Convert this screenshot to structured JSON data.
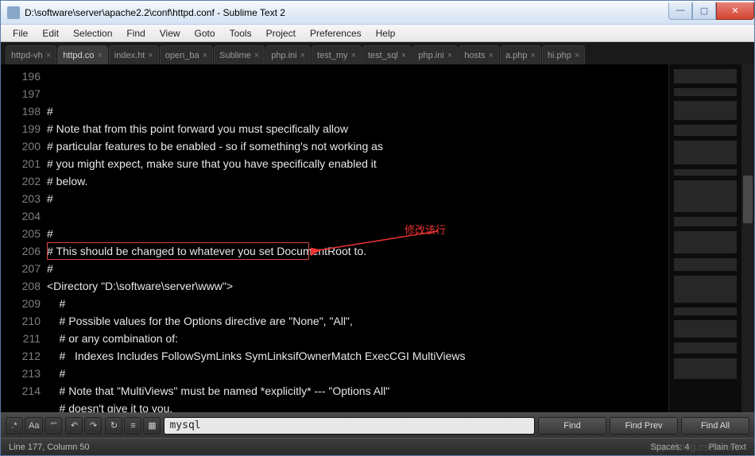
{
  "title": "D:\\software\\server\\apache2.2\\conf\\httpd.conf - Sublime Text 2",
  "menu": [
    "File",
    "Edit",
    "Selection",
    "Find",
    "View",
    "Goto",
    "Tools",
    "Project",
    "Preferences",
    "Help"
  ],
  "tabs": [
    {
      "label": "httpd-vh",
      "active": false
    },
    {
      "label": "httpd.co",
      "active": true
    },
    {
      "label": "index.ht",
      "active": false
    },
    {
      "label": "open_ba",
      "active": false
    },
    {
      "label": "Sublime",
      "active": false
    },
    {
      "label": "php.ini",
      "active": false
    },
    {
      "label": "test_my",
      "active": false
    },
    {
      "label": "test_sql",
      "active": false
    },
    {
      "label": "php.ini",
      "active": false
    },
    {
      "label": "hosts",
      "active": false
    },
    {
      "label": "a.php",
      "active": false
    },
    {
      "label": "hi.php",
      "active": false
    }
  ],
  "lines": [
    {
      "n": 196,
      "t": "#"
    },
    {
      "n": 197,
      "t": "# Note that from this point forward you must specifically allow"
    },
    {
      "n": 198,
      "t": "# particular features to be enabled - so if something's not working as"
    },
    {
      "n": 199,
      "t": "# you might expect, make sure that you have specifically enabled it"
    },
    {
      "n": 200,
      "t": "# below."
    },
    {
      "n": 201,
      "t": "#"
    },
    {
      "n": 202,
      "t": ""
    },
    {
      "n": 203,
      "t": "#"
    },
    {
      "n": 204,
      "t": "# This should be changed to whatever you set DocumentRoot to."
    },
    {
      "n": 205,
      "t": "#"
    },
    {
      "n": 206,
      "t": "<Directory \"D:\\software\\server\\www\">"
    },
    {
      "n": 207,
      "t": "    #"
    },
    {
      "n": 208,
      "t": "    # Possible values for the Options directive are \"None\", \"All\","
    },
    {
      "n": 209,
      "t": "    # or any combination of:"
    },
    {
      "n": 210,
      "t": "    #   Indexes Includes FollowSymLinks SymLinksifOwnerMatch ExecCGI MultiViews"
    },
    {
      "n": 211,
      "t": "    #"
    },
    {
      "n": 212,
      "t": "    # Note that \"MultiViews\" must be named *explicitly* --- \"Options All\""
    },
    {
      "n": 213,
      "t": "    # doesn't give it to you."
    },
    {
      "n": 214,
      "t": "    #"
    }
  ],
  "annotation": "修改该行",
  "find": {
    "value": "mysql",
    "regex_icon": ".*",
    "case_icon": "Aa",
    "word_icon": "“”",
    "undo_icon": "↶",
    "redo_icon": "↷",
    "wrap_icon": "↻",
    "sel_icon": "≡",
    "hl_icon": "▦",
    "find_btn": "Find",
    "prev_btn": "Find Prev",
    "all_btn": "Find All"
  },
  "status": {
    "pos": "Line 177, Column 50",
    "spaces": "Spaces: 4",
    "syntax": "Plain Text"
  },
  "win_controls": {
    "min": "—",
    "max": "▢",
    "close": "✕"
  },
  "watermark": "http://blog.csdn.net/"
}
